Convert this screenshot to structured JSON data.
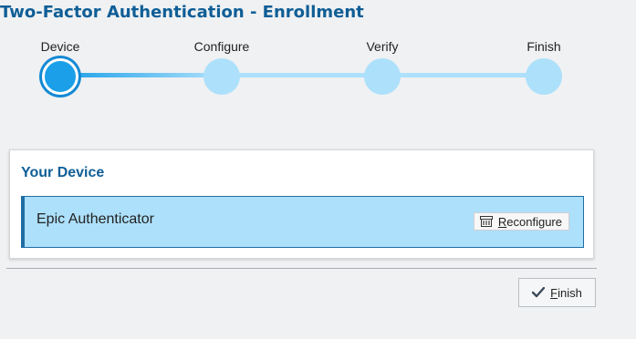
{
  "page": {
    "title": "Two-Factor Authentication - Enrollment"
  },
  "stepper": {
    "steps": [
      {
        "label": "Device",
        "state": "active"
      },
      {
        "label": "Configure",
        "state": "pending"
      },
      {
        "label": "Verify",
        "state": "pending"
      },
      {
        "label": "Finish",
        "state": "pending"
      }
    ]
  },
  "card": {
    "title": "Your Device",
    "device": {
      "name": "Epic Authenticator",
      "reconfigure_label": "Reconfigure",
      "reconfigure_icon": "device-settings-icon"
    }
  },
  "footer": {
    "finish_label": "Finish",
    "finish_icon": "checkmark-icon"
  },
  "colors": {
    "title": "#0f5e96",
    "step_active": "#1a9fe8",
    "step_pending": "#ade0fb",
    "device_row_bg": "#ade0fb",
    "device_row_border": "#1e6ea5",
    "page_bg": "#eff1f3"
  }
}
